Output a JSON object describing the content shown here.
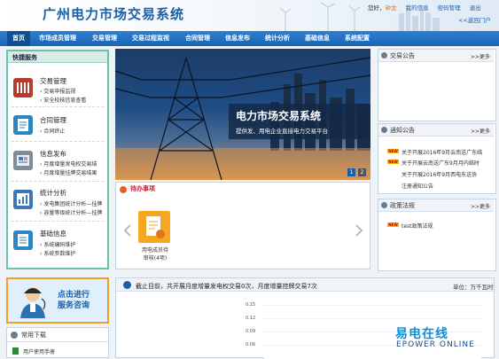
{
  "header": {
    "title": "广州电力市场交易系统",
    "greeting": "您好，",
    "username": "钟龙",
    "links": [
      "我的信息",
      "密码管理",
      "退出"
    ],
    "portal_link": "<<返回门户"
  },
  "nav": {
    "items": [
      "首页",
      "市场成员管理",
      "交易管理",
      "交易过程监视",
      "合同管理",
      "信息发布",
      "统计分析",
      "基础信息",
      "系统配置"
    ],
    "active": "首页"
  },
  "quick_service": {
    "title": "快捷服务",
    "groups": [
      {
        "title": "交易管理",
        "items": [
          "交易申报监视",
          "安全校核信息查看"
        ],
        "icon": "trade-icon",
        "color": "#c0392b"
      },
      {
        "title": "合同管理",
        "items": [
          "合同终止"
        ],
        "icon": "contract-icon",
        "color": "#2e86c1"
      },
      {
        "title": "信息发布",
        "items": [
          "月度增量发电权交易结",
          "月度增量挂牌交易结果"
        ],
        "icon": "info-icon",
        "color": "#5d6d7e"
      },
      {
        "title": "统计分析",
        "items": [
          "发电集团统计分析—挂牌",
          "容量等级统计分析—挂牌"
        ],
        "icon": "stats-icon",
        "color": "#3a78b8"
      },
      {
        "title": "基础信息",
        "items": [
          "系统编码维护",
          "系统参数维护"
        ],
        "icon": "base-icon",
        "color": "#2e86c1"
      }
    ]
  },
  "consult": {
    "line1": "点击进行",
    "line2": "服务咨询"
  },
  "common_downloads": {
    "title": "常用下载",
    "items": [
      "用户使用手册"
    ]
  },
  "banner": {
    "title": "电力市场交易系统",
    "subtitle": "提供发、用电企业直接电力交易平台",
    "pages": [
      "1",
      "2"
    ]
  },
  "todo": {
    "title": "待办事项",
    "items": [
      {
        "line1": "用电成员待",
        "line2": "审核(4项)"
      }
    ]
  },
  "announcements": {
    "title": "交易公告",
    "more": ">>更多"
  },
  "notices": {
    "title": "通知公告",
    "more": ">>更多",
    "items": [
      {
        "text": "关于开展2016年9月云南送广东临",
        "is_new": true
      },
      {
        "text": "关于开展云南送广东9月月内临时",
        "is_new": true
      },
      {
        "text": "关于开展2016年9月西电东送协",
        "is_new": false
      },
      {
        "text": "注册通知公告",
        "is_new": false
      }
    ]
  },
  "policy": {
    "title": "政策法规",
    "more": ">>更多",
    "items": [
      {
        "text": "test政策法规",
        "is_new": true
      }
    ]
  },
  "stats": {
    "title": "截止目前，共开展月度增量发电权交易0次，月度增量挂牌交易7次",
    "unit": "单位：万千瓦时"
  },
  "chart_data": {
    "type": "bar",
    "categories": [],
    "values": [],
    "yticks": [
      0.15,
      0.12,
      0.09,
      0.06
    ]
  },
  "watermark": {
    "cn": "易电在线",
    "en": "EPOWER ONLINE"
  }
}
